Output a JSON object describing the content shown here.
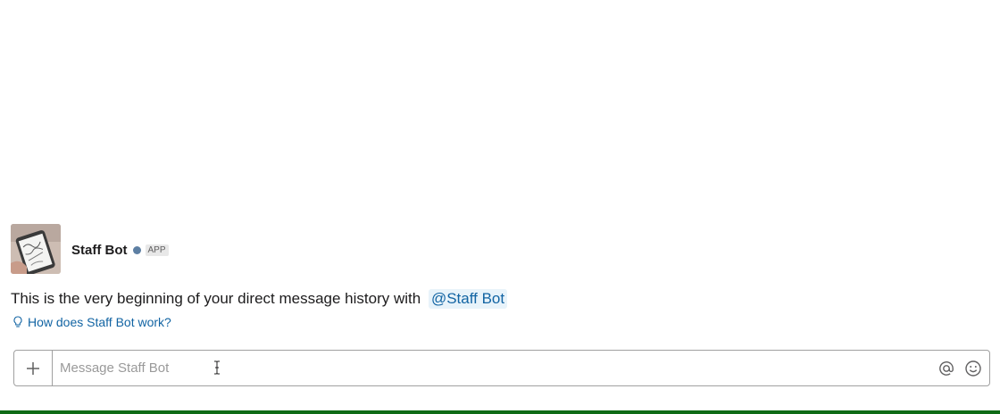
{
  "bot": {
    "name": "Staff Bot",
    "badge": "APP",
    "presence_color": "#5d7fa3"
  },
  "intro": {
    "history_text": "This is the very beginning of your direct message history with",
    "mention": "@Staff Bot",
    "help_link": "How does Staff Bot work?"
  },
  "composer": {
    "attach_icon": "plus-icon",
    "placeholder": "Message Staff Bot",
    "value": "",
    "mention_icon": "at-sign-icon",
    "emoji_icon": "smiley-icon"
  },
  "colors": {
    "link": "#1264a3",
    "mention_bg": "#e8f3fa",
    "bottom_bar": "#0e6b16"
  }
}
